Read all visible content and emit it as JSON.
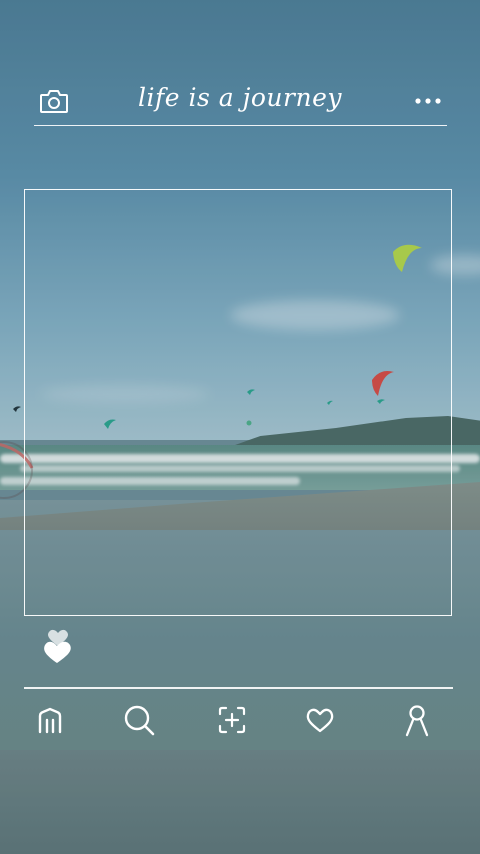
{
  "header": {
    "title": "life is a journey",
    "camera_icon": "camera-icon",
    "more_icon": "more-dots-icon"
  },
  "post": {
    "image_description_icon": "photo-frame",
    "like_icon": "heart-stack-icon"
  },
  "bottom_nav": {
    "items": [
      {
        "icon": "home-icon"
      },
      {
        "icon": "search-icon"
      },
      {
        "icon": "add-post-icon"
      },
      {
        "icon": "heart-icon"
      },
      {
        "icon": "profile-icon"
      }
    ]
  },
  "colors": {
    "overlay_line": "#ffffff",
    "sky": "#5e92ad",
    "sea": "#6c8c92"
  }
}
